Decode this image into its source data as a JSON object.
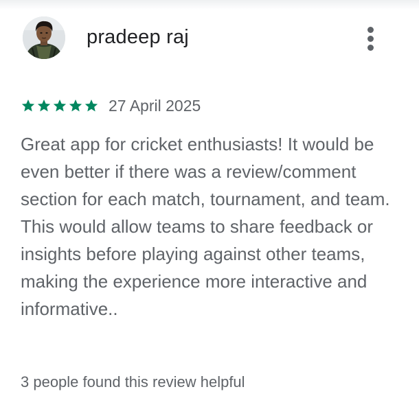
{
  "review": {
    "reviewer_name": "pradeep raj",
    "avatar_icon": "user-avatar-photo",
    "more_icon": "more-vert-icon",
    "rating": 5,
    "rating_max": 5,
    "star_color": "#01875f",
    "date": "27 April 2025",
    "text": "Great app for cricket enthusiasts! It would be even better if there was a review/comment section for each match, tournament, and team. This would allow teams to share feedback or insights before playing against other teams, making the experience more interactive and informative..",
    "helpful_text": "3 people found this review helpful"
  }
}
